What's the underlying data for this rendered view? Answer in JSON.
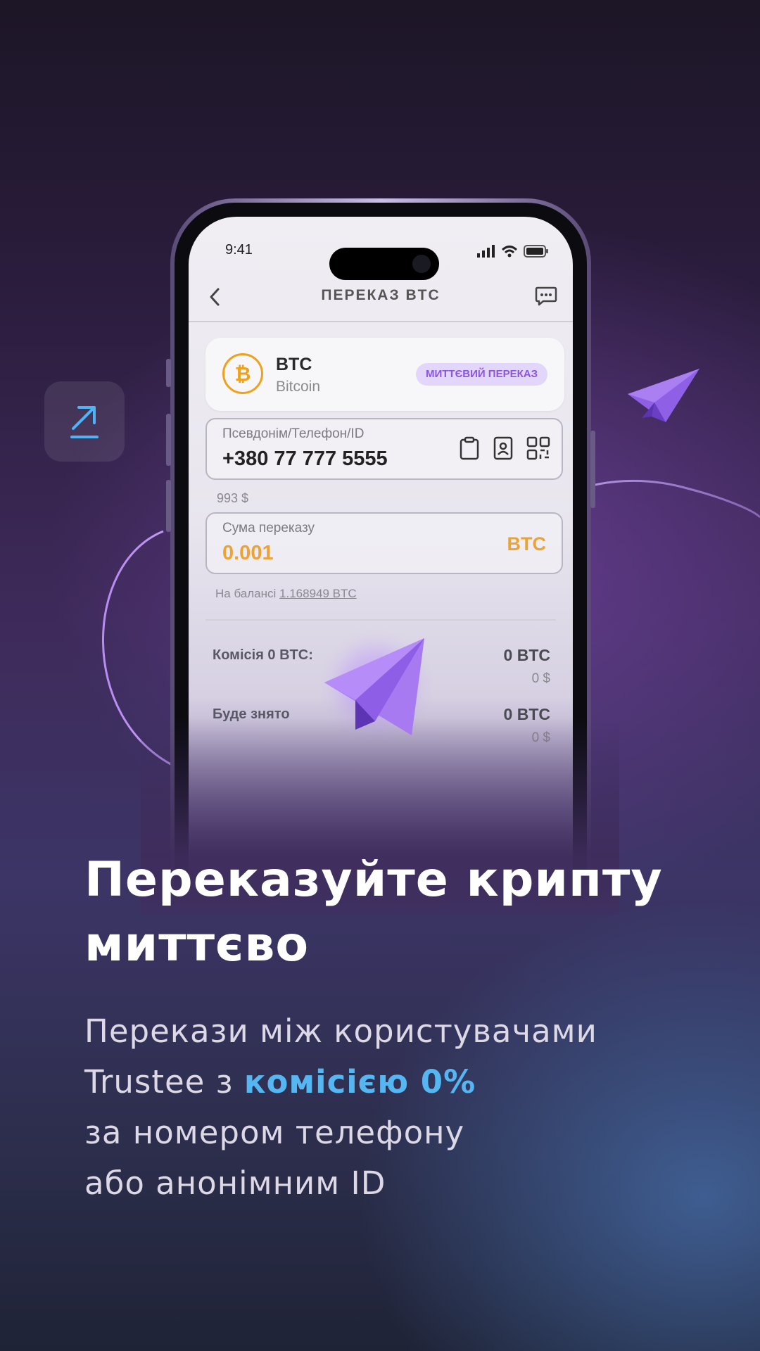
{
  "phone": {
    "status_time": "9:41",
    "nav_title": "ПЕРЕКАЗ BTC",
    "coin": {
      "symbol": "BTC",
      "name": "Bitcoin",
      "logo_glyph": "₿",
      "badge": "МИТТЄВИЙ ПЕРЕКАЗ"
    },
    "recipient": {
      "label": "Псевдонім/Телефон/ID",
      "value": "+380 77 777 5555"
    },
    "usd_hint": "993 $",
    "amount": {
      "label": "Сума переказу",
      "value": "0.001",
      "unit": "BTC"
    },
    "balance": {
      "prefix": "На балансі",
      "value": "1.168949 BTC"
    },
    "fee": {
      "label": "Комісія 0 BTC:",
      "value": "0 BTC",
      "usd": "0 $"
    },
    "withdrawn": {
      "label": "Буде знято",
      "value": "0 BTC",
      "usd": "0 $"
    }
  },
  "promo": {
    "headline_line1": "Переказуйте крипту",
    "headline_line2": "миттєво",
    "body_line1": "Перекази між користувачами",
    "body_line2_prefix": "Trustee з ",
    "body_line2_accent": "комісією 0%",
    "body_line3": "за номером телефону",
    "body_line4": "або анонімним ID"
  },
  "colors": {
    "accent_blue": "#55b6f2",
    "btc_orange": "#eba336",
    "badge_purple": "#8a56e0",
    "plane_purple": "#9b6cf0"
  }
}
